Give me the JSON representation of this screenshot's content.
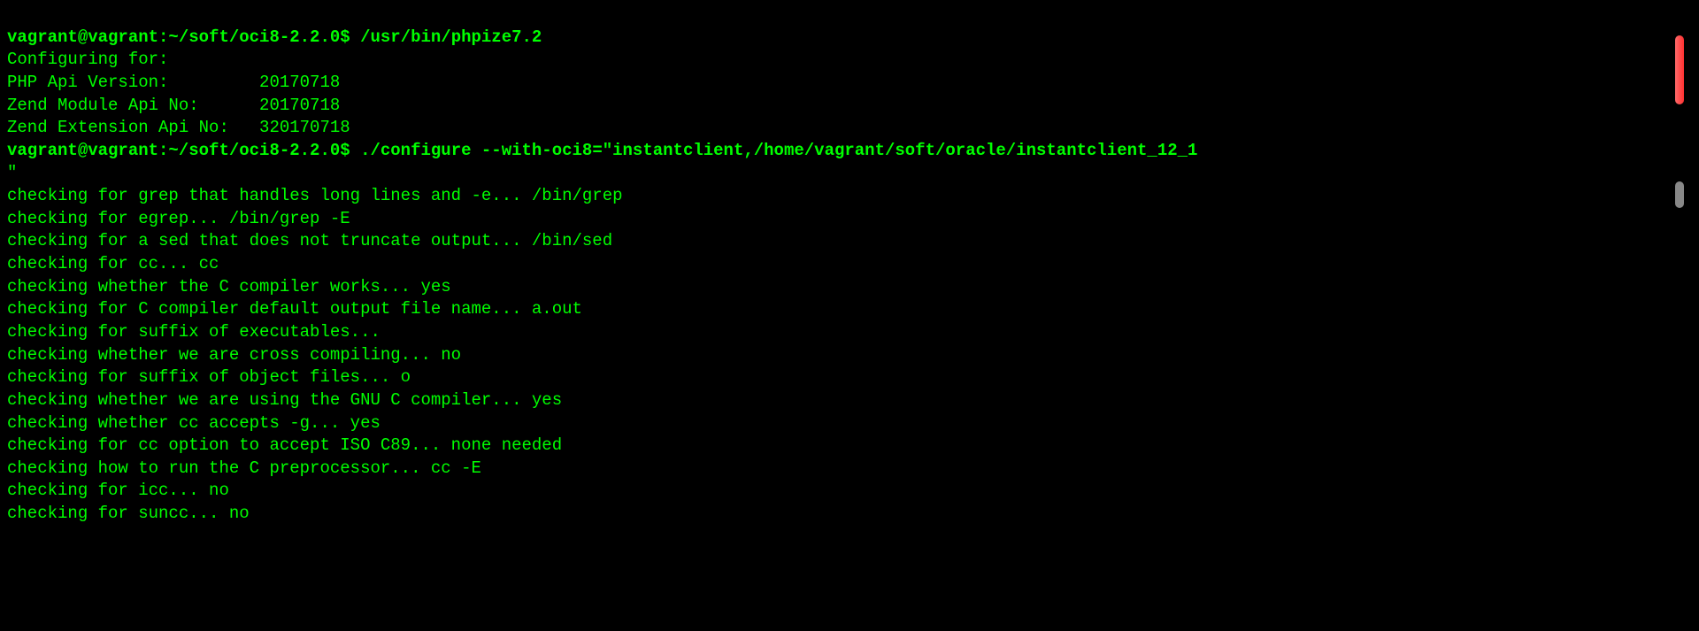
{
  "lines": [
    {
      "prompt": "vagrant@vagrant:~/soft/oci8-2.2.0$ ",
      "command": "/usr/bin/phpize7.2"
    },
    {
      "output": "Configuring for:"
    },
    {
      "output": "PHP Api Version:         20170718"
    },
    {
      "output": "Zend Module Api No:      20170718"
    },
    {
      "output": "Zend Extension Api No:   320170718"
    },
    {
      "prompt": "vagrant@vagrant:~/soft/oci8-2.2.0$ ",
      "command": "./configure --with-oci8=\"instantclient,/home/vagrant/soft/oracle/instantclient_12_1"
    },
    {
      "output": "\""
    },
    {
      "output": "checking for grep that handles long lines and -e... /bin/grep"
    },
    {
      "output": "checking for egrep... /bin/grep -E"
    },
    {
      "output": "checking for a sed that does not truncate output... /bin/sed"
    },
    {
      "output": "checking for cc... cc"
    },
    {
      "output": "checking whether the C compiler works... yes"
    },
    {
      "output": "checking for C compiler default output file name... a.out"
    },
    {
      "output": "checking for suffix of executables... "
    },
    {
      "output": "checking whether we are cross compiling... no"
    },
    {
      "output": "checking for suffix of object files... o"
    },
    {
      "output": "checking whether we are using the GNU C compiler... yes"
    },
    {
      "output": "checking whether cc accepts -g... yes"
    },
    {
      "output": "checking for cc option to accept ISO C89... none needed"
    },
    {
      "output": "checking how to run the C preprocessor... cc -E"
    },
    {
      "output": "checking for icc... no"
    },
    {
      "output": "checking for suncc... no"
    }
  ]
}
